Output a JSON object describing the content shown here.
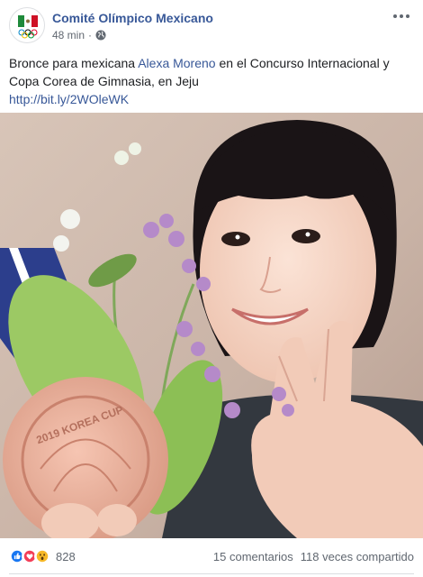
{
  "header": {
    "page_name": "Comité Olímpico Mexicano",
    "timestamp": "48 min",
    "separator": "·",
    "privacy_icon": "globe-icon",
    "more_icon": "more-options-icon",
    "avatar_icon": "mexican-olympic-committee-logo"
  },
  "post": {
    "text_before": "Bronce para mexicana ",
    "mention": "Alexa Moreno",
    "text_after": " en el Concurso Internacional y Copa Corea de Gimnasia, en Jeju",
    "link": "http://bit.ly/2WOleWK"
  },
  "photo": {
    "medal_text": "2019 KOREA CUP"
  },
  "footer": {
    "reaction_icons": [
      "like-icon",
      "love-icon",
      "wow-icon"
    ],
    "reaction_count": "828",
    "comments": "15 comentarios",
    "shares": "118 veces compartido"
  },
  "colors": {
    "link": "#385898",
    "meta": "#606770",
    "like": "#1877f2",
    "love": "#f33e58",
    "wow": "#f7b928"
  }
}
